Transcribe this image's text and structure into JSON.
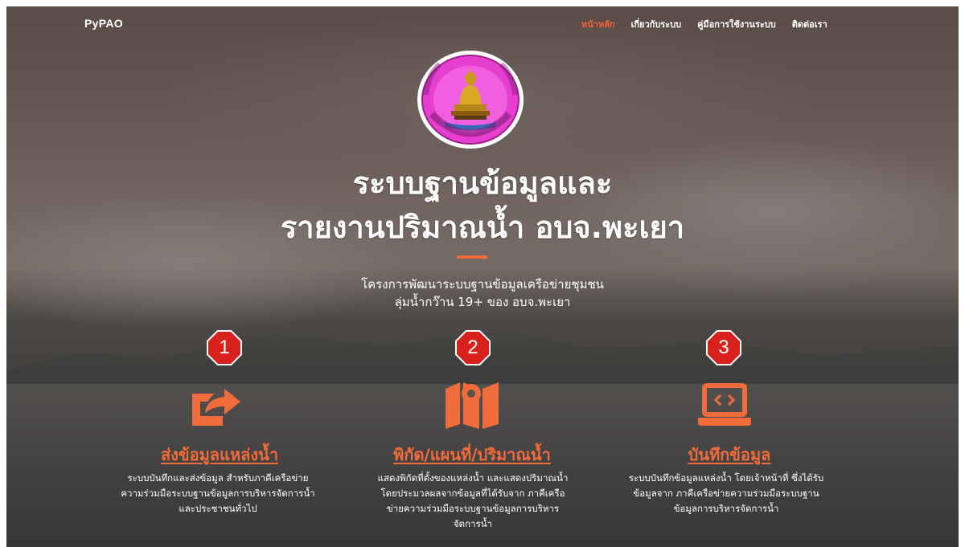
{
  "brand": "PyPAO",
  "nav": [
    {
      "label": "หน้าหลัก",
      "active": true
    },
    {
      "label": "เกี่ยวกับระบบ",
      "active": false
    },
    {
      "label": "คู่มือการใช้งานระบบ",
      "active": false
    },
    {
      "label": "ติดต่อเรา",
      "active": false
    }
  ],
  "hero": {
    "title_line1": "ระบบฐานข้อมูลและ",
    "title_line2": "รายงานปริมาณน้ำ อบจ.พะเยา",
    "subtitle_line1": "โครงการพัฒนาระบบฐานข้อมูลเครือข่ายชุมชน",
    "subtitle_line2": "ลุ่มน้ำกว๊าน 19+ ของ อบจ.พะเยา"
  },
  "features": [
    {
      "badge": "1",
      "icon": "share-icon",
      "title": "ส่งข้อมูลแหล่งน้ำ",
      "desc_lines": [
        "ระบบบันทึกและส่งข้อมูล สำหรับภาคีเครือข่าย",
        "ความร่วมมือระบบฐานข้อมูลการบริหารจัดการน้ำ",
        "และประชาชนทั่วไป"
      ]
    },
    {
      "badge": "2",
      "icon": "map-icon",
      "title": "พิกัด/แผนที่/ปริมาณน้ำ",
      "desc_lines": [
        "แสดงพิกัดที่ตั้งของแหล่งน้ำ และแสดงปริมาณน้ำ",
        "โดยประมวลผลจากข้อมูลที่ได้รับจาก ภาคีเครือ",
        "ข่ายความร่วมมือระบบฐานข้อมูลการบริหาร",
        "จัดการน้ำ"
      ]
    },
    {
      "badge": "3",
      "icon": "laptop-code-icon",
      "title": "บันทึกข้อมูล",
      "desc_lines": [
        "ระบบบันทึกข้อมูลแหล่งน้ำ โดยเจ้าหน้าที่ ซึ่งได้รับ",
        "ข้อมูลจาก ภาคีเครือข่ายความร่วมมือระบบฐาน",
        "ข้อมูลการบริหารจัดการน้ำ"
      ]
    }
  ],
  "colors": {
    "accent": "#f26b3a",
    "badge": "#d8201c"
  }
}
